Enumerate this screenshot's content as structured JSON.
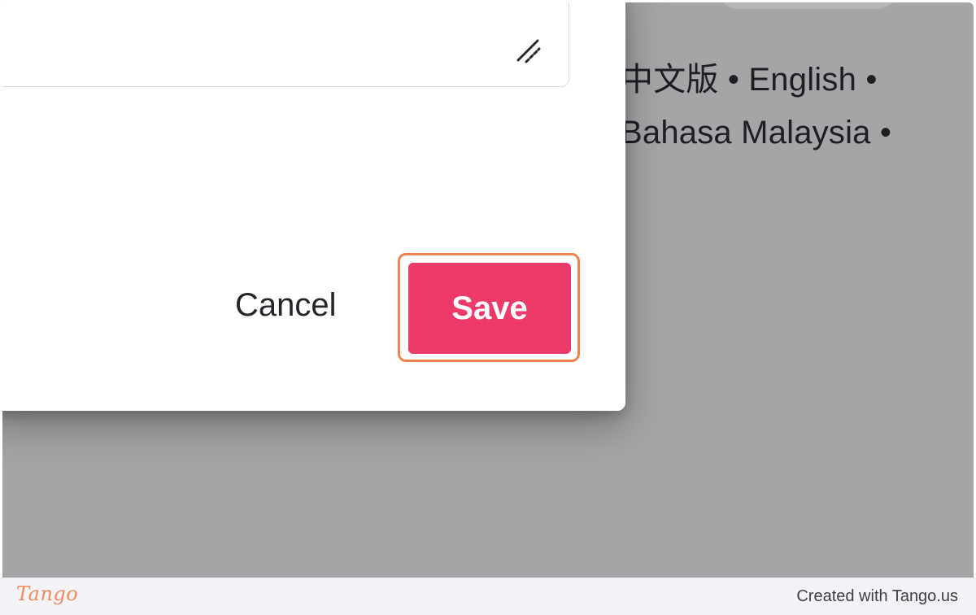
{
  "languages": {
    "line1": "中文版 • English •",
    "line2": "Bahasa Malaysia •"
  },
  "dialog": {
    "cancel_label": "Cancel",
    "save_label": "Save"
  },
  "footer": {
    "logo_text": "Tango",
    "credit_text": "Created with Tango.us"
  },
  "colors": {
    "save_button": "#ec3b6a",
    "highlight": "#f0824c",
    "overlay": "#a4a5a7",
    "logo": "#f28a5b"
  },
  "icons": {
    "resize": "resize-handle-icon"
  }
}
